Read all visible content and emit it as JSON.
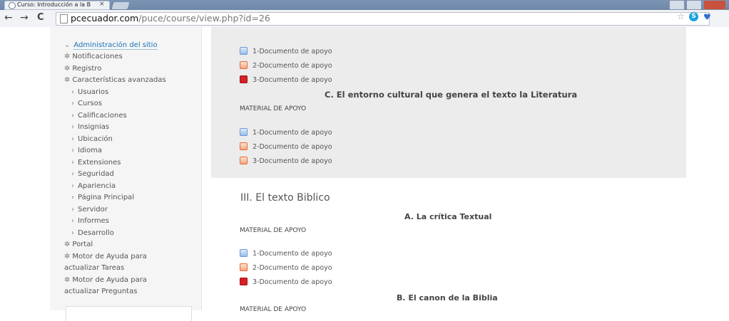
{
  "browser": {
    "tab_title": "Curso: Introducción a la B",
    "tab_close": "×",
    "url_host": "pcecuador.com",
    "url_path": "/puce/course/view.php?id=26",
    "back": "←",
    "forward": "→",
    "reload": "C",
    "star": "☆",
    "skype": "S",
    "ublock": "♥"
  },
  "sidebar": {
    "top": "Administración del sitio",
    "top_caret": "⌄",
    "items": [
      {
        "label": "Notificaciones",
        "kind": "gear"
      },
      {
        "label": "Registro",
        "kind": "gear"
      },
      {
        "label": "Características avanzadas",
        "kind": "gear"
      },
      {
        "label": "Usuarios",
        "kind": "sub"
      },
      {
        "label": "Cursos",
        "kind": "sub"
      },
      {
        "label": "Calificaciones",
        "kind": "sub"
      },
      {
        "label": "Insignias",
        "kind": "sub"
      },
      {
        "label": "Ubicación",
        "kind": "sub"
      },
      {
        "label": "Idioma",
        "kind": "sub"
      },
      {
        "label": "Extensiones",
        "kind": "sub"
      },
      {
        "label": "Seguridad",
        "kind": "sub"
      },
      {
        "label": "Apariencia",
        "kind": "sub"
      },
      {
        "label": "Página Principal",
        "kind": "sub"
      },
      {
        "label": "Servidor",
        "kind": "sub"
      },
      {
        "label": "Informes",
        "kind": "sub"
      },
      {
        "label": "Desarrollo",
        "kind": "sub"
      },
      {
        "label": "Portal",
        "kind": "gear"
      },
      {
        "label": "Motor de Ayuda para",
        "kind": "gear"
      },
      {
        "label": "actualizar Tareas",
        "kind": "cont"
      },
      {
        "label": "Motor de Ayuda para",
        "kind": "gear"
      },
      {
        "label": "actualizar Preguntas",
        "kind": "cont"
      }
    ]
  },
  "content": {
    "docs_a": [
      "1-Documento de apoyo",
      "2-Documento de apoyo",
      "3-Documento de apoyo"
    ],
    "heading_c": "C. El entorno cultural que genera el texto la Literatura",
    "material_c": "MATERIAL DE APOYO",
    "docs_c": [
      "1-Documento de apoyo",
      "2-Documento de apoyo",
      "3-Documento de apoyo"
    ],
    "section3_title": "III. El texto Biblico",
    "heading_3a": "A. La crítica Textual",
    "material_3a": "MATERIAL DE APOYO",
    "docs_3a": [
      "1-Documento de apoyo",
      "2-Documento de apoyo",
      "3-Documento de apoyo"
    ],
    "heading_3b": "B. El canon de la Biblia",
    "material_3b_partial": "MATERIAL DE APOYO"
  }
}
